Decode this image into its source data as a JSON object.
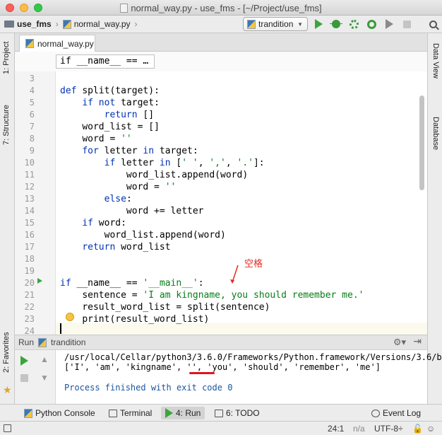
{
  "window": {
    "title": "normal_way.py - use_fms - [~/Project/use_fms]"
  },
  "navbar": {
    "project": "use_fms",
    "file": "normal_way.py",
    "run_config": "trandition"
  },
  "side_left": {
    "project": "1: Project",
    "structure": "7: Structure",
    "favorites": "2: Favorites"
  },
  "side_right": {
    "dataview": "Data View",
    "database": "Database"
  },
  "editor": {
    "tab": "normal_way.py",
    "breadcrumb": "if __name__ == …",
    "line_numbers": [
      "3",
      "4",
      "5",
      "6",
      "7",
      "8",
      "9",
      "10",
      "11",
      "12",
      "13",
      "14",
      "15",
      "16",
      "17",
      "18",
      "19",
      "20",
      "21",
      "22",
      "23",
      "24"
    ],
    "lines": [
      "",
      "def split(target):",
      "    if not target:",
      "        return []",
      "    word_list = []",
      "    word = ''",
      "    for letter in target:",
      "        if letter in [' ', ',', '.']:",
      "            word_list.append(word)",
      "            word = ''",
      "        else:",
      "            word += letter",
      "    if word:",
      "        word_list.append(word)",
      "    return word_list",
      "",
      "",
      "if __name__ == '__main__':",
      "    sentence = 'I am kingname, you should remember me.'",
      "    result_word_list = split(sentence)",
      "    print(result_word_list)",
      ""
    ],
    "annotation": "空格"
  },
  "run": {
    "label": "Run",
    "config": "trandition",
    "output": [
      "/usr/local/Cellar/python3/3.6.0/Frameworks/Python.framework/Versions/3.6/b",
      "['I', 'am', 'kingname', '', 'you', 'should', 'remember', 'me']",
      "",
      "Process finished with exit code 0"
    ]
  },
  "bottom_tabs": {
    "python_console": "Python Console",
    "terminal": "Terminal",
    "run": "4: Run",
    "todo": "6: TODO",
    "event_log": "Event Log"
  },
  "status": {
    "position": "24:1",
    "na": "n/a",
    "encoding": "UTF-8÷"
  }
}
